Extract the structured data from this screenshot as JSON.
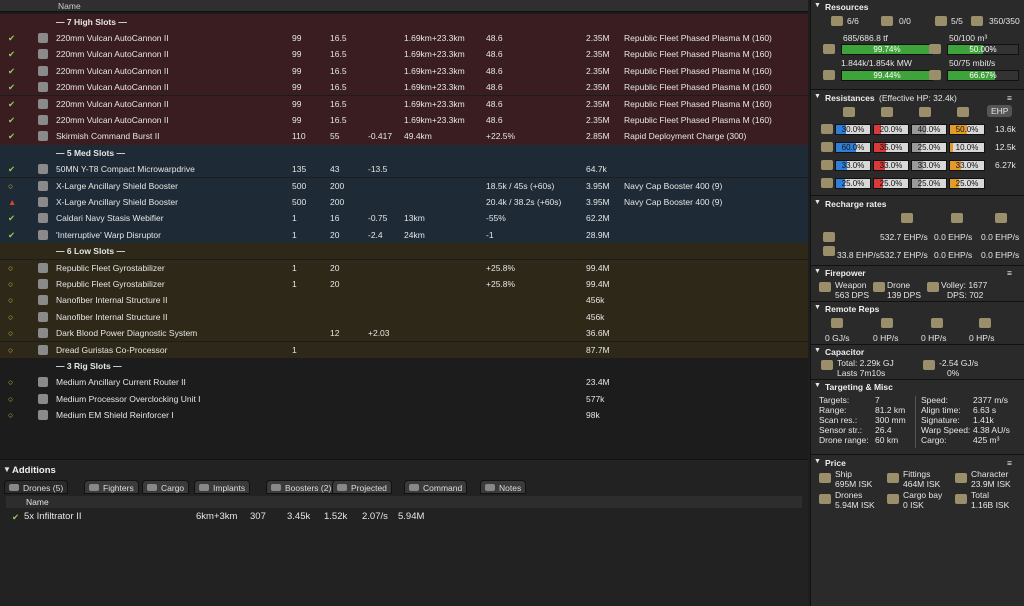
{
  "header": {
    "name": "Name"
  },
  "high_label": "— 7 High Slots —",
  "high": [
    {
      "name": "220mm Vulcan AutoCannon II",
      "a": "99",
      "b": "16.5",
      "c": "",
      "d": "1.69km+23.3km",
      "e": "48.6",
      "f": "2.35M",
      "g": "Republic Fleet Phased Plasma M (160)"
    },
    {
      "name": "220mm Vulcan AutoCannon II",
      "a": "99",
      "b": "16.5",
      "c": "",
      "d": "1.69km+23.3km",
      "e": "48.6",
      "f": "2.35M",
      "g": "Republic Fleet Phased Plasma M (160)"
    },
    {
      "name": "220mm Vulcan AutoCannon II",
      "a": "99",
      "b": "16.5",
      "c": "",
      "d": "1.69km+23.3km",
      "e": "48.6",
      "f": "2.35M",
      "g": "Republic Fleet Phased Plasma M (160)"
    },
    {
      "name": "220mm Vulcan AutoCannon II",
      "a": "99",
      "b": "16.5",
      "c": "",
      "d": "1.69km+23.3km",
      "e": "48.6",
      "f": "2.35M",
      "g": "Republic Fleet Phased Plasma M (160)"
    },
    {
      "name": "220mm Vulcan AutoCannon II",
      "a": "99",
      "b": "16.5",
      "c": "",
      "d": "1.69km+23.3km",
      "e": "48.6",
      "f": "2.35M",
      "g": "Republic Fleet Phased Plasma M (160)"
    },
    {
      "name": "220mm Vulcan AutoCannon II",
      "a": "99",
      "b": "16.5",
      "c": "",
      "d": "1.69km+23.3km",
      "e": "48.6",
      "f": "2.35M",
      "g": "Republic Fleet Phased Plasma M (160)"
    },
    {
      "name": "Skirmish Command Burst II",
      "a": "110",
      "b": "55",
      "c": "-0.417",
      "d": "49.4km",
      "e": "+22.5%",
      "f": "2.85M",
      "g": "Rapid Deployment Charge (300)"
    }
  ],
  "med_label": "— 5 Med Slots —",
  "med": [
    {
      "st": "✔",
      "name": "50MN Y-T8 Compact Microwarpdrive",
      "a": "135",
      "b": "43",
      "c": "-13.5",
      "d": "",
      "e": "",
      "f": "64.7k",
      "g": ""
    },
    {
      "st": "○",
      "name": "X-Large Ancillary Shield Booster",
      "a": "500",
      "b": "200",
      "c": "",
      "d": "",
      "e": "18.5k / 45s (+60s)",
      "f": "3.95M",
      "g": "Navy Cap Booster 400 (9)"
    },
    {
      "st": "▲",
      "name": "X-Large Ancillary Shield Booster",
      "a": "500",
      "b": "200",
      "c": "",
      "d": "",
      "e": "20.4k / 38.2s (+60s)",
      "f": "3.95M",
      "g": "Navy Cap Booster 400 (9)"
    },
    {
      "st": "✔",
      "name": "Caldari Navy Stasis Webifier",
      "a": "1",
      "b": "16",
      "c": "-0.75",
      "d": "13km",
      "e": "-55%",
      "f": "62.2M",
      "g": ""
    },
    {
      "st": "✔",
      "name": "'Interruptive' Warp Disruptor",
      "a": "1",
      "b": "20",
      "c": "-2.4",
      "d": "24km",
      "e": "-1",
      "f": "28.9M",
      "g": ""
    }
  ],
  "low_label": "— 6 Low Slots —",
  "low": [
    {
      "name": "Republic Fleet Gyrostabilizer",
      "a": "1",
      "b": "20",
      "c": "",
      "e": "+25.8%",
      "f": "99.4M"
    },
    {
      "name": "Republic Fleet Gyrostabilizer",
      "a": "1",
      "b": "20",
      "c": "",
      "e": "+25.8%",
      "f": "99.4M"
    },
    {
      "name": "Nanofiber Internal Structure II",
      "a": "",
      "b": "",
      "c": "",
      "e": "",
      "f": "456k"
    },
    {
      "name": "Nanofiber Internal Structure II",
      "a": "",
      "b": "",
      "c": "",
      "e": "",
      "f": "456k"
    },
    {
      "name": "Dark Blood Power Diagnostic System",
      "a": "",
      "b": "12",
      "c": "+2.03",
      "e": "",
      "f": "36.6M"
    },
    {
      "name": "Dread Guristas Co-Processor",
      "a": "1",
      "b": "",
      "c": "",
      "e": "",
      "f": "87.7M"
    }
  ],
  "rig_label": "— 3 Rig Slots —",
  "rig": [
    {
      "name": "Medium Ancillary Current Router II",
      "f": "23.4M"
    },
    {
      "name": "Medium Processor Overclocking Unit I",
      "f": "577k"
    },
    {
      "name": "Medium EM Shield Reinforcer I",
      "f": "98k"
    }
  ],
  "additions": {
    "title": "Additions",
    "tabs": [
      "Drones (5)",
      "Fighters",
      "Cargo",
      "Implants",
      "Boosters (2)",
      "Projected",
      "Command",
      "Notes"
    ],
    "col_name": "Name",
    "drone": {
      "name": "5x Infiltrator II",
      "range": "6km+3km",
      "a": "307",
      "b": "3.45k",
      "c": "1.52k",
      "d": "2.07/s",
      "e": "5.94M"
    }
  },
  "resources": {
    "title": "Resources",
    "turrets": "6/6",
    "launchers": "0/0",
    "calib": "5/5",
    "drone_bay": "350/350",
    "cpu_text": "685/686.8 tf",
    "cpu_pct": "99.74%",
    "cpu_frac": 0.9974,
    "drone_bw_text": "50/100 m³",
    "drone_bw_pct": "50.00%",
    "drone_bw_frac": 0.5,
    "pg_text": "1.844k/1.854k MW",
    "pg_pct": "99.44%",
    "pg_frac": 0.9944,
    "bw_text": "50/75 mbit/s",
    "bw_pct": "66.67%",
    "bw_frac": 0.6667
  },
  "resist": {
    "title": "Resistances",
    "ehp": "(Effective HP: 32.4k)",
    "ehp_btn": "EHP",
    "rows": [
      {
        "v": [
          "30.0%",
          "20.0%",
          "40.0%",
          "50.0%"
        ],
        "f": [
          0.3,
          0.2,
          0.4,
          0.5
        ],
        "hp": "13.6k"
      },
      {
        "v": [
          "60.0%",
          "35.0%",
          "25.0%",
          "10.0%"
        ],
        "f": [
          0.6,
          0.35,
          0.25,
          0.1
        ],
        "hp": "12.5k"
      },
      {
        "v": [
          "33.0%",
          "33.0%",
          "33.0%",
          "33.0%"
        ],
        "f": [
          0.33,
          0.33,
          0.33,
          0.33
        ],
        "hp": "6.27k"
      },
      {
        "v": [
          "25.0%",
          "25.0%",
          "25.0%",
          "25.0%"
        ],
        "f": [
          0.25,
          0.25,
          0.25,
          0.25
        ],
        "hp": ""
      }
    ],
    "colors": [
      "#2f7fd8",
      "#d83a3a",
      "#9a9a9a",
      "#e39a2a"
    ]
  },
  "recharge": {
    "title": "Recharge rates",
    "r1": [
      "532.7 EHP/s",
      "0.0 EHP/s",
      "0.0 EHP/s"
    ],
    "r2": [
      "33.8 EHP/s",
      "532.7 EHP/s",
      "0.0 EHP/s",
      "0.0 EHP/s"
    ]
  },
  "firepower": {
    "title": "Firepower",
    "weapon": "Weapon",
    "weapon_dps": "563 DPS",
    "drone": "Drone",
    "drone_dps": "139 DPS",
    "volley": "Volley: 1677",
    "dps": "DPS: 702"
  },
  "reps": {
    "title": "Remote Reps",
    "v": [
      "0 GJ/s",
      "0 HP/s",
      "0 HP/s",
      "0 HP/s"
    ]
  },
  "cap": {
    "title": "Capacitor",
    "total": "Total: 2.29k GJ",
    "lasts": "Lasts 7m10s",
    "delta": "-2.54 GJ/s",
    "pct": "0%"
  },
  "targeting": {
    "title": "Targeting & Misc",
    "left": [
      [
        "Targets:",
        "7"
      ],
      [
        "Range:",
        "81.2 km"
      ],
      [
        "Scan res.:",
        "300 mm"
      ],
      [
        "Sensor str.:",
        "26.4"
      ],
      [
        "Drone range:",
        "60 km"
      ]
    ],
    "right": [
      [
        "Speed:",
        "2377 m/s"
      ],
      [
        "Align time:",
        "6.63 s"
      ],
      [
        "Signature:",
        "1.41k"
      ],
      [
        "Warp Speed:",
        "4.38 AU/s"
      ],
      [
        "Cargo:",
        "425 m³"
      ]
    ]
  },
  "price": {
    "title": "Price",
    "ship": "Ship",
    "ship_v": "695M ISK",
    "fit": "Fittings",
    "fit_v": "464M ISK",
    "char": "Character",
    "char_v": "23.9M ISK",
    "drones": "Drones",
    "drones_v": "5.94M ISK",
    "cargo": "Cargo bay",
    "cargo_v": "0 ISK",
    "total": "Total",
    "total_v": "1.16B ISK"
  }
}
